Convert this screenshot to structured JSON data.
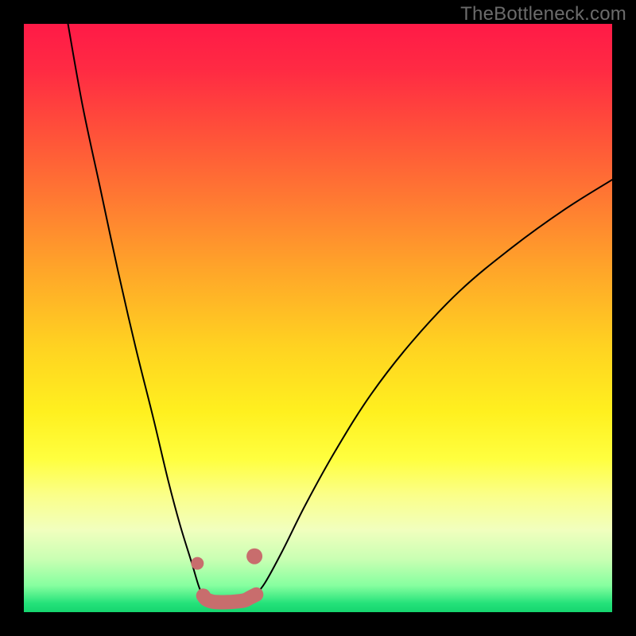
{
  "watermark": {
    "text": "TheBottleneck.com"
  },
  "gradient": {
    "stops": [
      {
        "offset": 0.0,
        "color": "#ff1a47"
      },
      {
        "offset": 0.08,
        "color": "#ff2b43"
      },
      {
        "offset": 0.18,
        "color": "#ff4f3a"
      },
      {
        "offset": 0.3,
        "color": "#ff7a32"
      },
      {
        "offset": 0.42,
        "color": "#ffa629"
      },
      {
        "offset": 0.55,
        "color": "#ffd321"
      },
      {
        "offset": 0.66,
        "color": "#fff01f"
      },
      {
        "offset": 0.74,
        "color": "#ffff3f"
      },
      {
        "offset": 0.8,
        "color": "#fbff88"
      },
      {
        "offset": 0.86,
        "color": "#f1ffbe"
      },
      {
        "offset": 0.91,
        "color": "#c9ffb3"
      },
      {
        "offset": 0.955,
        "color": "#86ff9f"
      },
      {
        "offset": 0.985,
        "color": "#24e27a"
      },
      {
        "offset": 1.0,
        "color": "#15d56f"
      }
    ]
  },
  "chart_data": {
    "type": "line",
    "title": "",
    "xlabel": "",
    "ylabel": "",
    "xlim": [
      0,
      1
    ],
    "ylim": [
      0,
      1
    ],
    "series": [
      {
        "name": "left-curve",
        "x": [
          0.075,
          0.1,
          0.13,
          0.16,
          0.19,
          0.22,
          0.245,
          0.265,
          0.285,
          0.297,
          0.305
        ],
        "y": [
          1.0,
          0.86,
          0.72,
          0.58,
          0.45,
          0.33,
          0.225,
          0.15,
          0.085,
          0.045,
          0.025
        ],
        "stroke": "#000000",
        "width": 2
      },
      {
        "name": "right-curve",
        "x": [
          0.39,
          0.41,
          0.44,
          0.48,
          0.53,
          0.59,
          0.66,
          0.74,
          0.83,
          0.92,
          1.0
        ],
        "y": [
          0.025,
          0.05,
          0.105,
          0.185,
          0.275,
          0.37,
          0.46,
          0.545,
          0.62,
          0.685,
          0.735
        ],
        "stroke": "#000000",
        "width": 2
      },
      {
        "name": "trough-marker",
        "x": [
          0.305,
          0.31,
          0.32,
          0.33,
          0.345,
          0.36,
          0.375,
          0.385,
          0.395
        ],
        "y": [
          0.028,
          0.022,
          0.018,
          0.017,
          0.017,
          0.018,
          0.02,
          0.025,
          0.03
        ],
        "stroke": "#c86d6d",
        "width": 18
      }
    ],
    "markers": [
      {
        "name": "dot-left",
        "x": 0.295,
        "y": 0.083,
        "r": 8,
        "color": "#c86d6d"
      },
      {
        "name": "dot-right",
        "x": 0.392,
        "y": 0.095,
        "r": 10,
        "color": "#c86d6d"
      }
    ]
  }
}
